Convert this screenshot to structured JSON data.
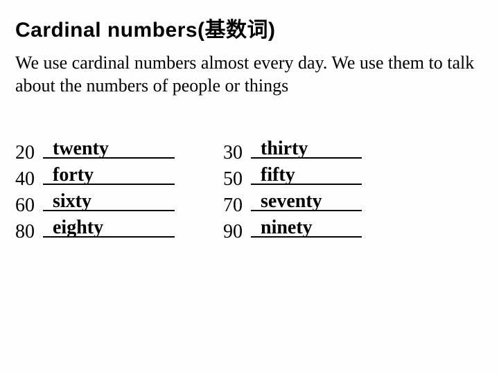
{
  "title": "Cardinal numbers(基数词)",
  "intro": "We use cardinal numbers almost every day. We use them to talk about the numbers of people or things",
  "left": [
    {
      "num": "20",
      "word": "twenty"
    },
    {
      "num": "40",
      "word": "forty"
    },
    {
      "num": "60",
      "word": "sixty"
    },
    {
      "num": "80",
      "word": "eighty"
    }
  ],
  "right": [
    {
      "num": "30",
      "word": "thirty"
    },
    {
      "num": "50",
      "word": "fifty"
    },
    {
      "num": "70",
      "word": "seventy"
    },
    {
      "num": "90",
      "word": "ninety"
    }
  ]
}
